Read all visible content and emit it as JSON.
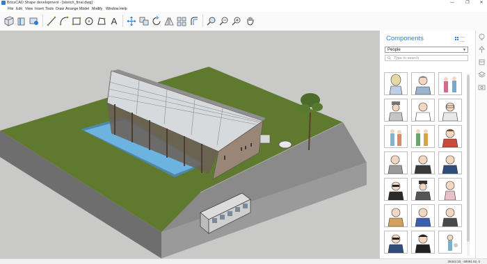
{
  "window": {
    "title": "BricsCAD Shape development - [sketch_final.dwg]",
    "controls": [
      "—",
      "❐",
      "✕"
    ]
  },
  "menu": [
    "File",
    "Edit",
    "View",
    "Insert",
    "Tools",
    "Draw",
    "Arrange",
    "Model",
    "Modify",
    "Window",
    "Help"
  ],
  "toolbar": {
    "tools": [
      "wall-icon",
      "door-icon",
      "window-tool-icon",
      "line-icon",
      "arc-icon",
      "rectangle-icon",
      "circle-icon",
      "polyline-icon",
      "text-icon",
      "move-icon",
      "copy-icon",
      "rotate-icon",
      "mirror-icon",
      "array-icon",
      "offset-icon",
      "zoom-window-icon",
      "zoom-out-icon",
      "zoom-in-icon",
      "pan-icon"
    ],
    "text_tool_glyph": "A"
  },
  "panel": {
    "title": "Components",
    "category": "People",
    "search_placeholder": "Type to search"
  },
  "right_sidebar": [
    "lightbulb-icon",
    "lamp-icon",
    "library-icon",
    "layers-icon",
    "camera-icon"
  ],
  "status": {
    "coords": "25342.22, -30091.02, 0"
  },
  "colors": {
    "accent": "#2c7bd6",
    "grass": "#5f7a2e",
    "road": "#8a8a8a",
    "water": "#6db3e0"
  }
}
